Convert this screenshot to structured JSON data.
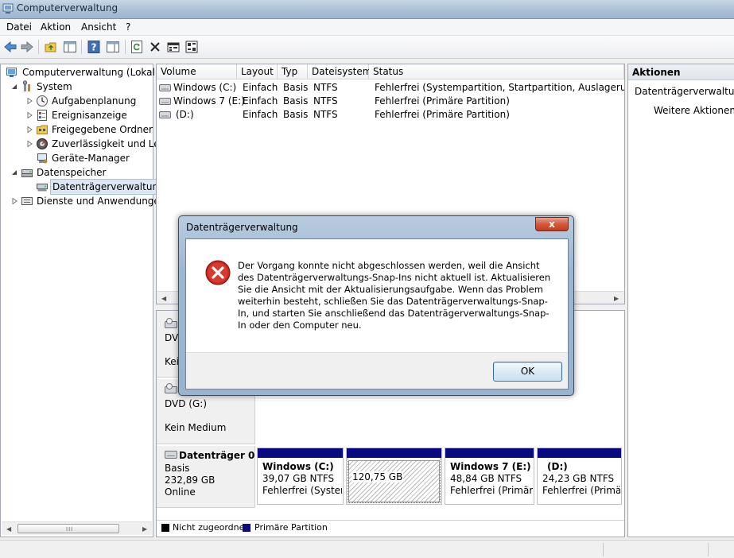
{
  "window": {
    "title": "Computerverwaltung"
  },
  "menu": [
    "Datei",
    "Aktion",
    "Ansicht",
    "?"
  ],
  "tree": {
    "items": [
      {
        "label": "Computerverwaltung (Lokal)",
        "icon": "computer-management-icon",
        "level": 0,
        "expander": "none"
      },
      {
        "label": "System",
        "icon": "system-tools-icon",
        "level": 1,
        "expander": "expanded"
      },
      {
        "label": "Aufgabenplanung",
        "icon": "clock-icon",
        "level": 2,
        "expander": "collapsed"
      },
      {
        "label": "Ereignisanzeige",
        "icon": "event-viewer-icon",
        "level": 2,
        "expander": "collapsed"
      },
      {
        "label": "Freigegebene Ordner",
        "icon": "shared-folder-icon",
        "level": 2,
        "expander": "collapsed"
      },
      {
        "label": "Zuverlässigkeit und Leis",
        "icon": "performance-icon",
        "level": 2,
        "expander": "collapsed"
      },
      {
        "label": "Geräte-Manager",
        "icon": "device-manager-icon",
        "level": 2,
        "expander": "none"
      },
      {
        "label": "Datenspeicher",
        "icon": "storage-icon",
        "level": 1,
        "expander": "expanded"
      },
      {
        "label": "Datenträgerverwaltung",
        "icon": "disk-management-icon",
        "level": 2,
        "expander": "none",
        "selected": true
      },
      {
        "label": "Dienste und Anwendungen",
        "icon": "services-icon",
        "level": 1,
        "expander": "collapsed"
      }
    ]
  },
  "volumes": {
    "columns": [
      "Volume",
      "Layout",
      "Typ",
      "Dateisystem",
      "Status"
    ],
    "rows": [
      [
        "Windows (C:)",
        "Einfach",
        "Basis",
        "NTFS",
        "Fehlerfrei (Systempartition, Startpartition, Auslagerungsdatei"
      ],
      [
        "Windows 7 (E:)",
        "Einfach",
        "Basis",
        "NTFS",
        "Fehlerfrei (Primäre Partition)"
      ],
      [
        "(D:)",
        "Einfach",
        "Basis",
        "NTFS",
        "Fehlerfrei (Primäre Partition)"
      ]
    ]
  },
  "disks": {
    "dvd1": {
      "lines": [
        "DVD",
        "Kein"
      ]
    },
    "dvd2": {
      "name": "DVD (G:)",
      "status": "Kein Medium"
    },
    "disk0": {
      "name": "Datenträger 0",
      "type": "Basis",
      "size": "232,89 GB",
      "status": "Online",
      "partitions": [
        {
          "name": "Windows  (C:)",
          "size": "39,07 GB NTFS",
          "status": "Fehlerfrei (Systempartition"
        },
        {
          "name": "",
          "size": "120,75 GB",
          "status": ""
        },
        {
          "name": "Windows 7  (E:)",
          "size": "48,84 GB NTFS",
          "status": "Fehlerfrei (Primäre"
        },
        {
          "name": "(D:)",
          "size": "24,23 GB NTFS",
          "status": "Fehlerfrei (Primäre"
        }
      ]
    }
  },
  "legend": [
    {
      "label": "Nicht zugeordnet",
      "color": "#000000"
    },
    {
      "label": "Primäre Partition",
      "color": "#0a0a80"
    }
  ],
  "actions": {
    "header": "Aktionen",
    "items": [
      "Datenträgerverwaltung",
      "Weitere Aktionen"
    ]
  },
  "dialog": {
    "title": "Datenträgerverwaltung",
    "close": "x",
    "message": "Der Vorgang konnte nicht abgeschlossen werden, weil die Ansicht des Datenträgerverwaltungs-Snap-Ins nicht aktuell ist. Aktualisieren Sie die Ansicht mit der Aktualisierungsaufgabe. Wenn das Problem weiterhin besteht, schließen Sie das Datenträgerverwaltungs-Snap-In, und starten Sie anschließend das Datenträgerverwaltungs-Snap-In oder den Computer neu.",
    "ok": "OK",
    "icon": "error-icon"
  },
  "scroll": {
    "grip": "III"
  }
}
